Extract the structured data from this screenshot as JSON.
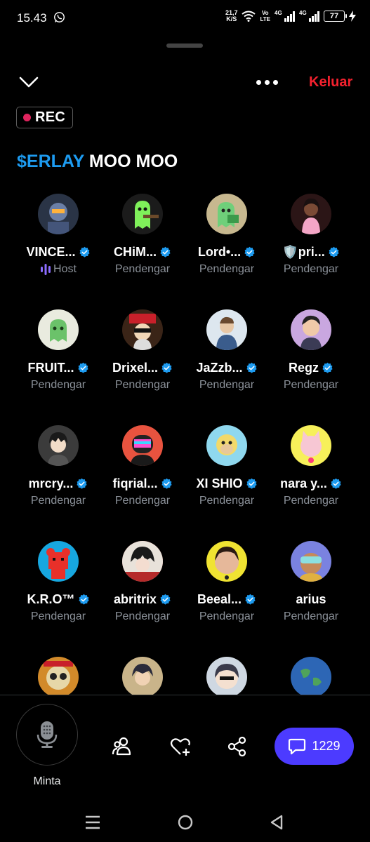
{
  "status_bar": {
    "time": "15.43",
    "net_speed_value": "21,7",
    "net_speed_unit": "K/S",
    "volte_top": "Vo",
    "volte_bottom": "LTE",
    "signal1_label": "4G",
    "signal2_label": "4G",
    "battery": "77"
  },
  "header": {
    "leave_label": "Keluar",
    "rec_label": "REC"
  },
  "space": {
    "title_cashtag": "$ERLAY",
    "title_rest": " MOO MOO"
  },
  "participants": [
    {
      "name": "VINCE...",
      "role": "Host",
      "verified": true,
      "avatar": "robot-avatar",
      "bg": "#2a3446"
    },
    {
      "name": "CHiM...",
      "role": "Pendengar",
      "verified": true,
      "avatar": "green-ghost-gun-avatar",
      "bg": "#1b1b1b"
    },
    {
      "name": "Lord•...",
      "role": "Pendengar",
      "verified": true,
      "avatar": "green-ghost-money-avatar",
      "bg": "#c7b88f"
    },
    {
      "name": "🛡️pri...",
      "role": "Pendengar",
      "verified": true,
      "avatar": "woman-pink-avatar",
      "bg": "#2b1516"
    },
    {
      "name": "FRUIT...",
      "role": "Pendengar",
      "verified": true,
      "avatar": "green-ghost-avatar",
      "bg": "#e9ebdf"
    },
    {
      "name": "Drixel...",
      "role": "Pendengar",
      "verified": true,
      "avatar": "santa-sunglasses-avatar",
      "bg": "#3a2417"
    },
    {
      "name": "JaZzb...",
      "role": "Pendengar",
      "verified": true,
      "avatar": "man-blue-avatar",
      "bg": "#dde7ef"
    },
    {
      "name": "Regz",
      "role": "Pendengar",
      "verified": true,
      "avatar": "cartoon-man-avatar",
      "bg": "#c9a7e0"
    },
    {
      "name": "mrcry...",
      "role": "Pendengar",
      "verified": true,
      "avatar": "anime-boy-avatar",
      "bg": "#3b3b3b"
    },
    {
      "name": "fiqrial...",
      "role": "Pendengar",
      "verified": true,
      "avatar": "rainbow-helmet-avatar",
      "bg": "#e8533f"
    },
    {
      "name": "XI SHIO",
      "role": "Pendengar",
      "verified": true,
      "avatar": "ape-avatar",
      "bg": "#8fd8ee"
    },
    {
      "name": "nara y...",
      "role": "Pendengar",
      "verified": true,
      "avatar": "pink-cat-avatar",
      "bg": "#f7f05a"
    },
    {
      "name": "K.R.O™",
      "role": "Pendengar",
      "verified": true,
      "avatar": "red-bear-avatar",
      "bg": "#17a7e0"
    },
    {
      "name": "abritrix",
      "role": "Pendengar",
      "verified": true,
      "avatar": "manga-face-avatar",
      "bg": "#c43a3a"
    },
    {
      "name": "Beeal...",
      "role": "Pendengar",
      "verified": true,
      "avatar": "woman-face-avatar",
      "bg": "#f0e332"
    },
    {
      "name": "arius",
      "role": "Pendengar",
      "verified": false,
      "avatar": "vr-monkey-avatar",
      "bg": "#7a82e0"
    },
    {
      "name": "",
      "role": "",
      "verified": false,
      "avatar": "skull-avatar",
      "bg": "#d28a2a"
    },
    {
      "name": "",
      "role": "",
      "verified": false,
      "avatar": "anime-warrior-avatar",
      "bg": "#c9b48a"
    },
    {
      "name": "",
      "role": "",
      "verified": false,
      "avatar": "chibi-boy-avatar",
      "bg": "#cfd8e2"
    },
    {
      "name": "",
      "role": "",
      "verified": false,
      "avatar": "earth-avatar",
      "bg": "#2d66b5"
    }
  ],
  "bottom_bar": {
    "mic_label": "Minta",
    "chat_count": "1229"
  },
  "colors": {
    "accent": "#1d9bf0",
    "leave": "#f4212e",
    "rec_dot": "#e0245e",
    "chat_button": "#4c3bff",
    "muted_text": "#8b9199"
  }
}
